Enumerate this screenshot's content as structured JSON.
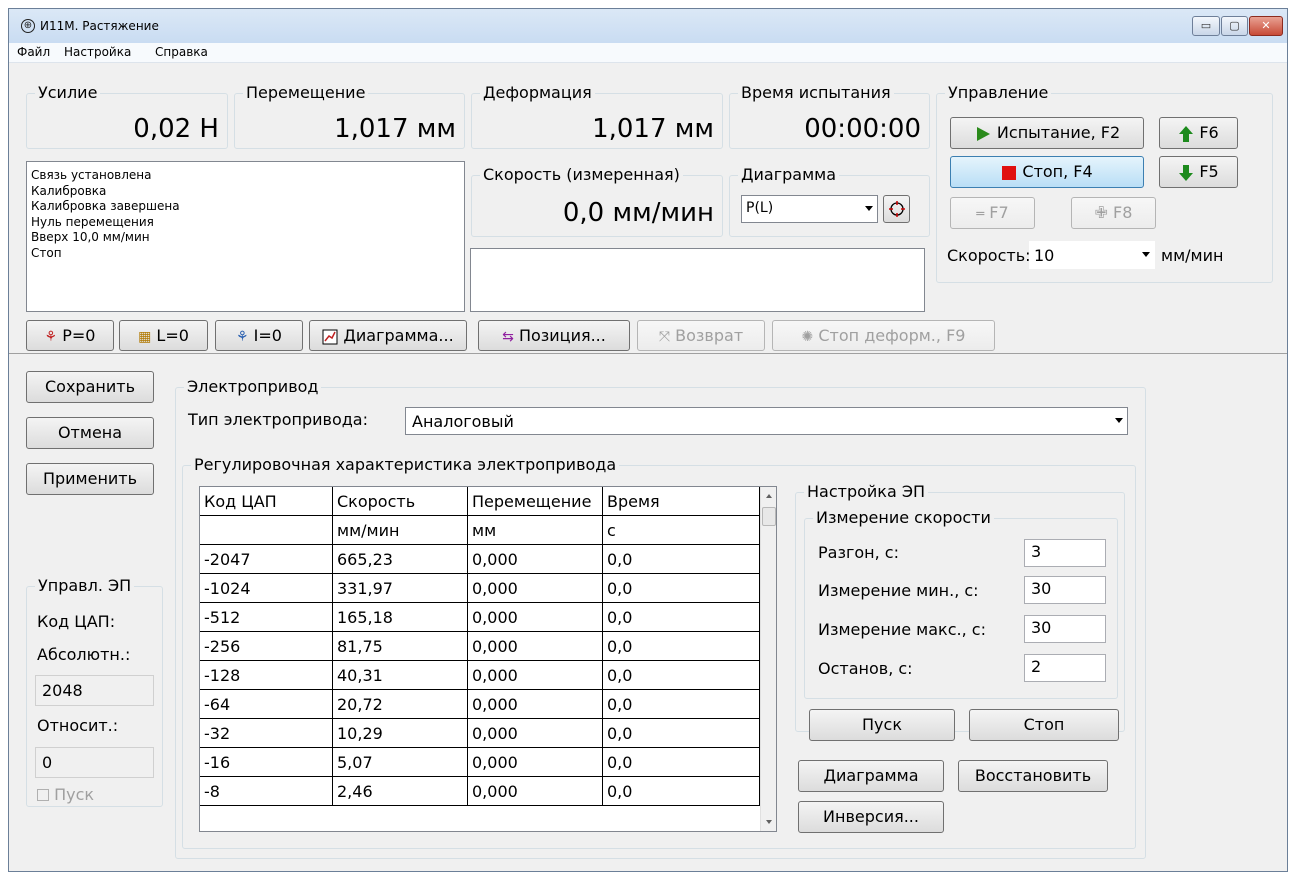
{
  "window": {
    "title": "И11М. Растяжение",
    "min": "▭",
    "max": "▢",
    "close": "✕"
  },
  "menu": [
    "Файл",
    "Настройка",
    "Справка"
  ],
  "readouts": {
    "force": {
      "label": "Усилие",
      "value": "0,02 Н"
    },
    "displacement": {
      "label": "Перемещение",
      "value": "1,017 мм"
    },
    "deformation": {
      "label": "Деформация",
      "value": "1,017 мм"
    },
    "time": {
      "label": "Время испытания",
      "value": "00:00:00"
    },
    "speed": {
      "label": "Скорость (измеренная)",
      "value": "0,0 мм/мин"
    }
  },
  "log": [
    "Связь установлена",
    "Калибровка",
    "Калибровка завершена",
    "Нуль перемещения",
    "Вверх 10,0 мм/мин",
    "Стоп"
  ],
  "diagram": {
    "label": "Диаграмма",
    "value": "P(L)"
  },
  "control": {
    "label": "Управление",
    "test_btn": "Испытание, F2",
    "stop_btn": "Стоп, F4",
    "f6": "F6",
    "f5": "F5",
    "f7": "F7",
    "f8": "F8",
    "speed_label": "Скорость:",
    "speed_value": "10",
    "speed_unit": "мм/мин"
  },
  "toolbar": {
    "p0": "P=0",
    "l0": "L=0",
    "i0": "I=0",
    "diagram": "Диаграмма...",
    "position": "Позиция...",
    "return": "Возврат",
    "stop_def": "Стоп деформ., F9"
  },
  "left": {
    "save": "Сохранить",
    "cancel": "Отмена",
    "apply": "Применить",
    "group": "Управл. ЭП",
    "dac_code": "Код ЦАП:",
    "absolute": "Абсолютн.:",
    "abs_value": "2048",
    "relative": "Относит.:",
    "rel_value": "0",
    "start_check": "Пуск"
  },
  "drive": {
    "group": "Электропривод",
    "type_label": "Тип электропривода:",
    "type_value": "Аналоговый",
    "char_group": "Регулировочная характеристика электропривода",
    "table": {
      "headers": [
        "Код ЦАП",
        "Скорость",
        "Перемещение",
        "Время"
      ],
      "units": [
        "",
        "мм/мин",
        "мм",
        "с"
      ],
      "rows": [
        [
          "-2047",
          "665,23",
          "0,000",
          "0,0"
        ],
        [
          "-1024",
          "331,97",
          "0,000",
          "0,0"
        ],
        [
          "-512",
          "165,18",
          "0,000",
          "0,0"
        ],
        [
          "-256",
          "81,75",
          "0,000",
          "0,0"
        ],
        [
          "-128",
          "40,31",
          "0,000",
          "0,0"
        ],
        [
          "-64",
          "20,72",
          "0,000",
          "0,0"
        ],
        [
          "-32",
          "10,29",
          "0,000",
          "0,0"
        ],
        [
          "-16",
          "5,07",
          "0,000",
          "0,0"
        ],
        [
          "-8",
          "2,46",
          "0,000",
          "0,0"
        ]
      ]
    },
    "setup": {
      "group": "Настройка ЭП",
      "measure_group": "Измерение скорости",
      "accel_label": "Разгон, с:",
      "accel_value": "3",
      "min_label": "Измерение мин., с:",
      "min_value": "30",
      "max_label": "Измерение макс., с:",
      "max_value": "30",
      "stop_label": "Останов, с:",
      "stop_value": "2",
      "start_btn": "Пуск",
      "stop_btn": "Стоп",
      "diagram_btn": "Диаграмма",
      "restore_btn": "Восстановить",
      "invert_btn": "Инверсия..."
    }
  }
}
